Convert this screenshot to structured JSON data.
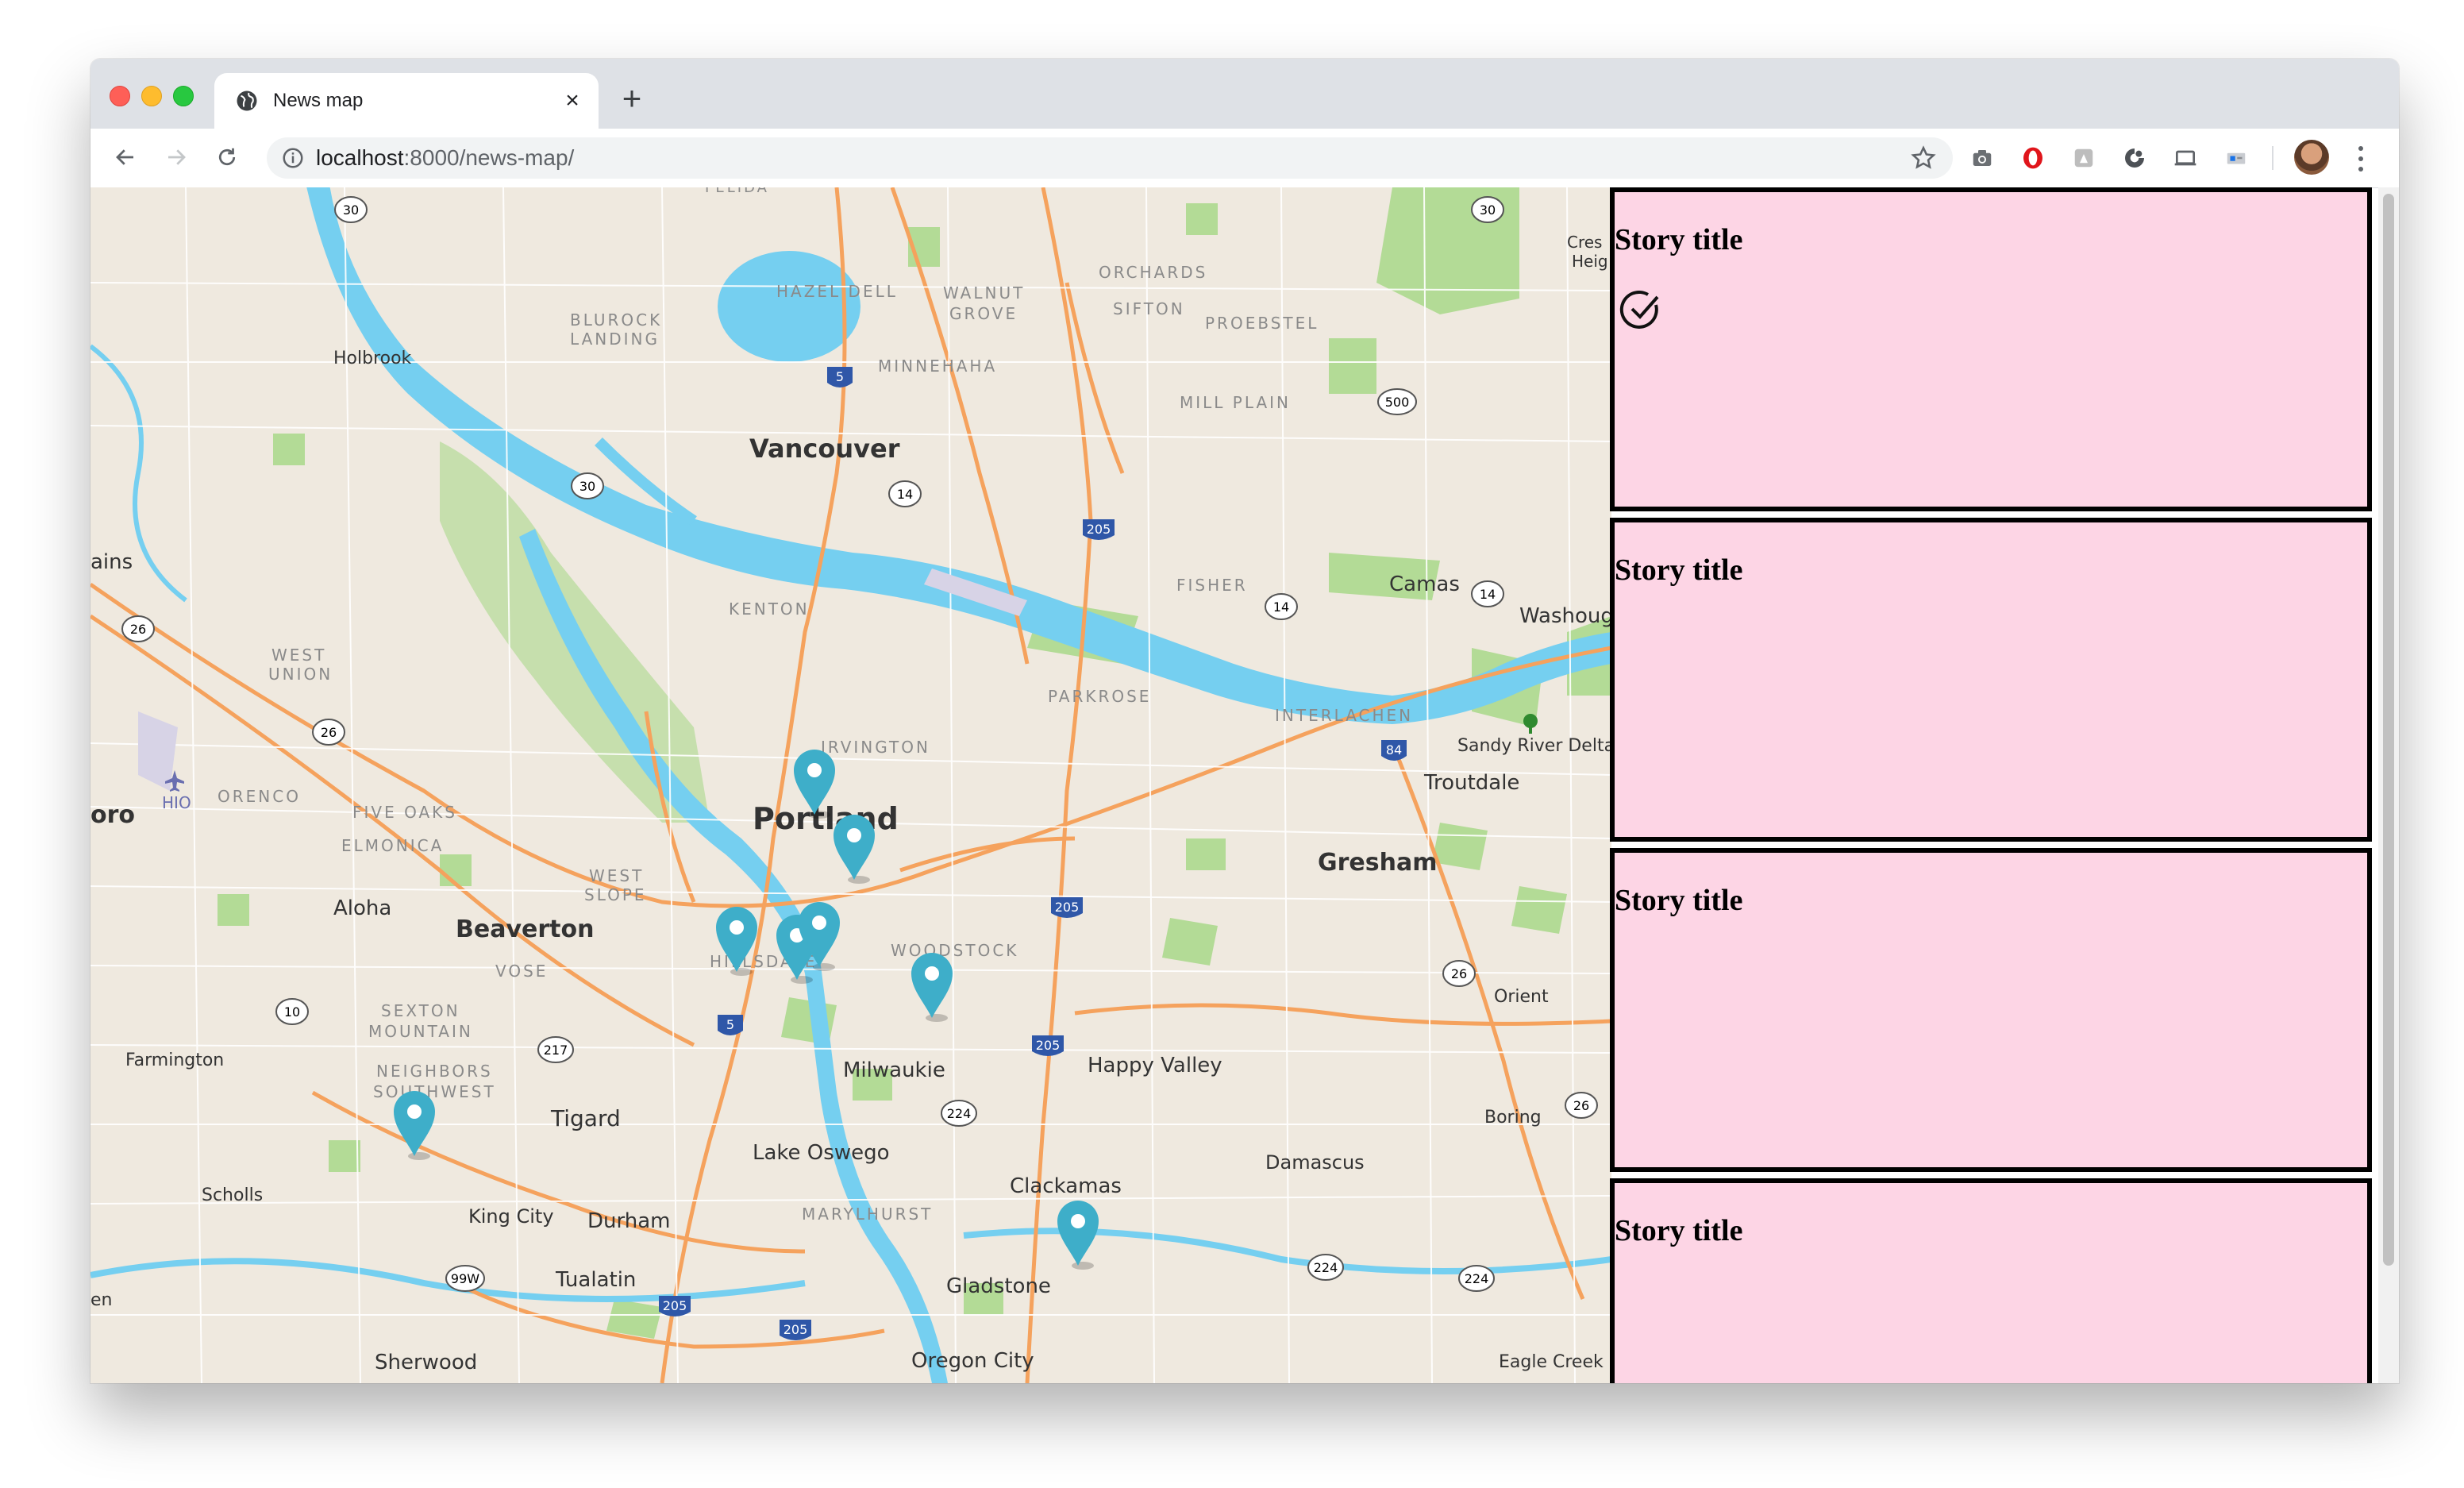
{
  "browser": {
    "tab_title": "News map",
    "url_host": "localhost",
    "url_path": ":8000/news-map/",
    "icons": [
      "back-arrow-icon",
      "forward-arrow-icon",
      "reload-icon",
      "info-icon",
      "star-icon",
      "camera-icon",
      "opera-icon",
      "drive-icon",
      "sync-icon",
      "cast-icon",
      "extension-icon"
    ]
  },
  "map": {
    "labels": {
      "vancouver": "Vancouver",
      "portland": "Portland",
      "beaverton": "Beaverton",
      "gresham": "Gresham",
      "troutdale": "Troutdale",
      "camas": "Camas",
      "washougal": "Washoug",
      "milwaukie": "Milwaukie",
      "happy_valley": "Happy Valley",
      "lake_oswego": "Lake Oswego",
      "clackamas": "Clackamas",
      "damascus": "Damascus",
      "tigard": "Tigard",
      "king_city": "King City",
      "durham": "Durham",
      "tualatin": "Tualatin",
      "sherwood": "Sherwood",
      "gladstone": "Gladstone",
      "oregon_city": "Oregon City",
      "aloha": "Aloha",
      "farmington": "Farmington",
      "scholls": "Scholls",
      "holbrook": "Holbrook",
      "boring": "Boring",
      "orient": "Orient",
      "eagle_creek": "Eagle Creek",
      "sandy_river": "Sandy River Delta",
      "hazel_dell": "HAZEL DELL",
      "walnut_grove_1": "WALNUT",
      "walnut_grove_2": "GROVE",
      "orchards": "ORCHARDS",
      "sifton": "SIFTON",
      "proebstel": "PROEBSTEL",
      "minnehaha": "MINNEHAHA",
      "mill_plain": "MILL PLAIN",
      "blurock_1": "BLUROCK",
      "blurock_2": "LANDING",
      "kenton": "KENTON",
      "fisher": "FISHER",
      "parkrose": "PARKROSE",
      "interlachen": "INTERLACHEN",
      "irvington": "IRVINGTON",
      "west_union_1": "WEST",
      "west_union_2": "UNION",
      "orenco": "ORENCO",
      "five_oaks": "FIVE OAKS",
      "elmonica": "ELMONICA",
      "west_slope_1": "WEST",
      "west_slope_2": "SLOPE",
      "hillsdale": "HILLSDALE",
      "woodstock": "WOODSTOCK",
      "vose": "VOSE",
      "sexton_1": "SEXTON",
      "sexton_2": "MOUNTAIN",
      "neighbors_1": "NEIGHBORS",
      "neighbors_2": "SOUTHWEST",
      "marylhurst": "MARYLHURST",
      "felida": "FELIDA",
      "hio": "HIO",
      "oro": "oro",
      "ains": "ains",
      "cres_1": "Cres",
      "cres_2": "Heig",
      "en": "en"
    },
    "shields": [
      "30",
      "5",
      "500",
      "14",
      "205",
      "30",
      "26",
      "14",
      "84",
      "26",
      "205",
      "26",
      "10",
      "217",
      "5",
      "205",
      "224",
      "26",
      "99W",
      "205",
      "205",
      "224",
      "224",
      "30",
      "14"
    ],
    "pins": [
      {
        "name": "pin-kenton"
      },
      {
        "name": "pin-irvington"
      },
      {
        "name": "pin-downtown-west"
      },
      {
        "name": "pin-downtown-center"
      },
      {
        "name": "pin-downtown-east"
      },
      {
        "name": "pin-southeast"
      },
      {
        "name": "pin-sexton-mountain"
      },
      {
        "name": "pin-happy-valley"
      }
    ]
  },
  "stories": [
    {
      "title": "Story title",
      "checked": true
    },
    {
      "title": "Story title",
      "checked": false
    },
    {
      "title": "Story title",
      "checked": false
    },
    {
      "title": "Story title",
      "checked": false
    }
  ],
  "colors": {
    "story_bg": "#fdd5e5",
    "water": "#75cff0",
    "park": "#a8d88a",
    "land": "#efe9df",
    "pin": "#3eaec9",
    "highway": "#f5a25d"
  }
}
